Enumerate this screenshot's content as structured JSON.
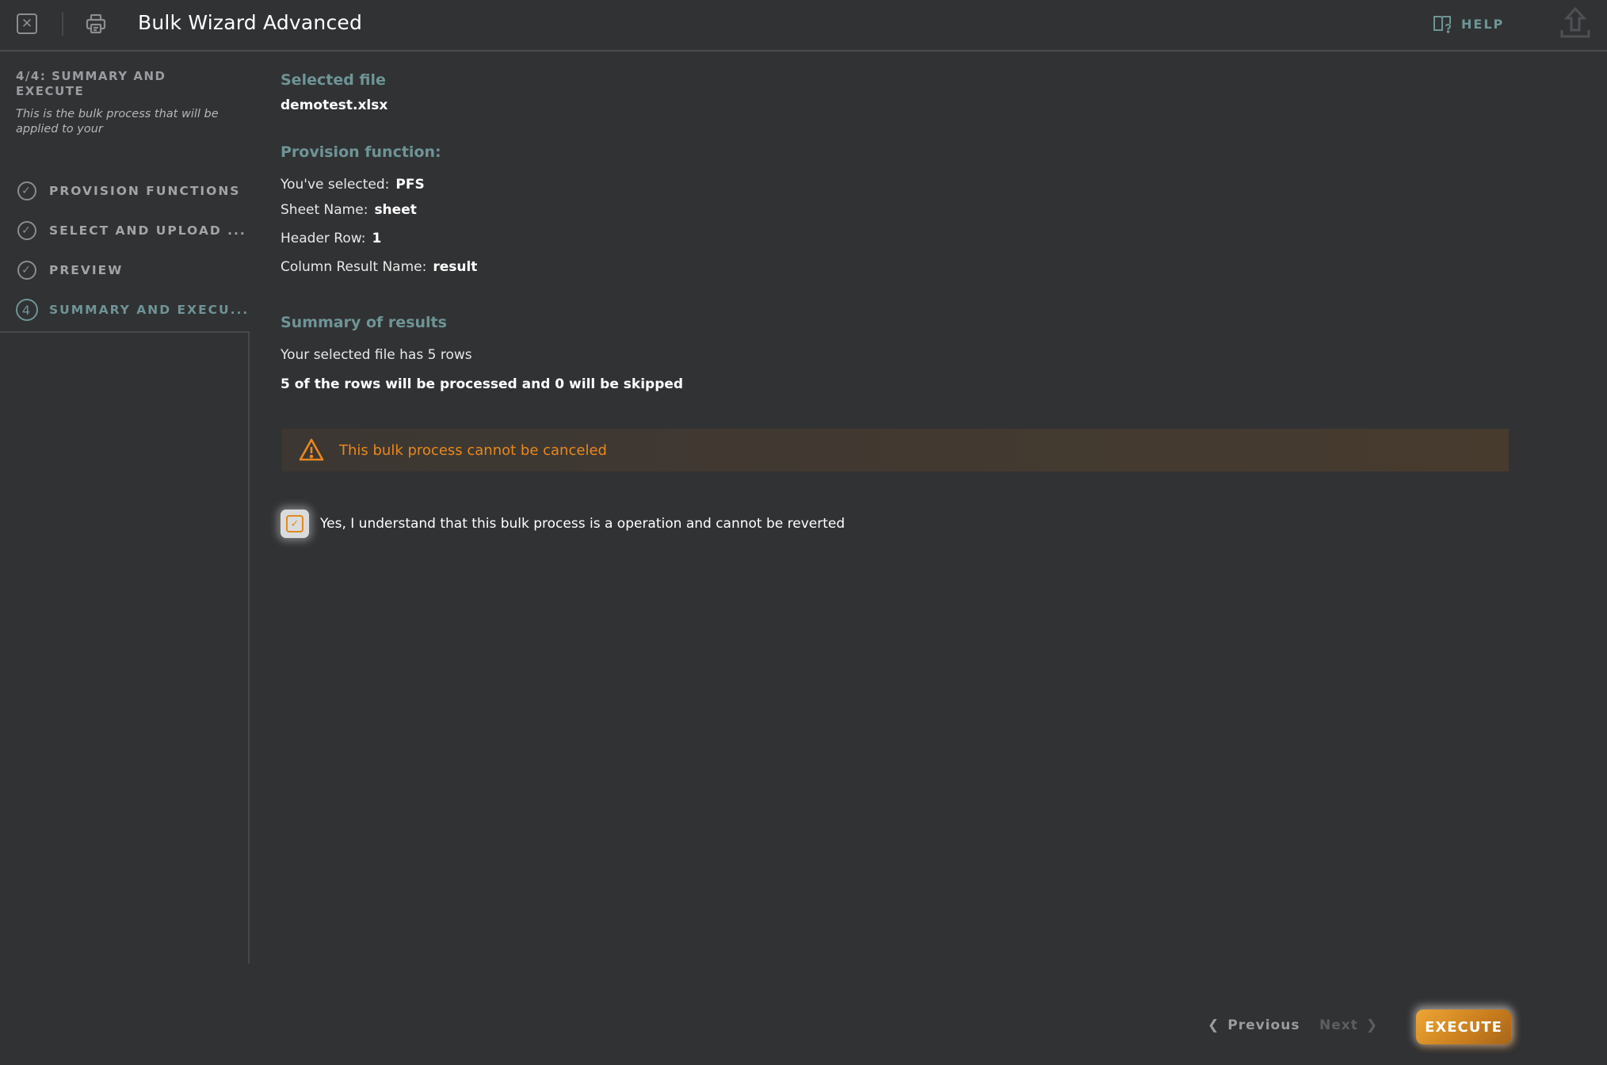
{
  "header": {
    "title": "Bulk Wizard Advanced",
    "help_label": "HELP",
    "icons": {
      "close": "close-square-icon",
      "print": "printer-icon",
      "help": "book-question-icon",
      "upload": "upload-icon"
    }
  },
  "sidebar": {
    "step_title": "4/4: SUMMARY AND EXECUTE",
    "step_description": "This is the bulk process that will be applied to your",
    "items": [
      {
        "label": "PROVISION FUNCTIONS",
        "icon": "check-circle-icon",
        "state": "completed"
      },
      {
        "label": "SELECT AND UPLOAD ...",
        "icon": "check-circle-icon",
        "state": "completed"
      },
      {
        "label": "PREVIEW",
        "icon": "check-circle-icon",
        "state": "completed"
      },
      {
        "label": "SUMMARY AND EXECU...",
        "icon": "step-number-icon",
        "number": "4",
        "state": "active"
      }
    ]
  },
  "main": {
    "selected_file": {
      "title": "Selected file",
      "value": "demotest.xlsx"
    },
    "provision": {
      "title": "Provision function:",
      "fields": [
        {
          "label": "You've selected:",
          "value": "PFS"
        },
        {
          "label": "Sheet Name:",
          "value": "sheet"
        },
        {
          "label": "Header Row:",
          "value": "1"
        },
        {
          "label": "Column Result Name:",
          "value": "result"
        }
      ]
    },
    "summary": {
      "title": "Summary of results",
      "rows_text": "Your selected file has 5 rows",
      "processed_text": "5 of the rows will be processed and 0 will be skipped"
    },
    "warning": {
      "icon": "warning-triangle-icon",
      "message": "This bulk process cannot be canceled",
      "color": "#e8881f"
    },
    "acknowledge": {
      "checked": true,
      "label": "Yes, I understand that this bulk process is a operation and cannot be reverted"
    }
  },
  "footer": {
    "previous_label": "Previous",
    "next_label": "Next",
    "next_disabled": true,
    "execute_label": "EXECUTE"
  },
  "colors": {
    "accent_teal": "#6e9496",
    "accent_orange": "#e08a1e",
    "background": "#313234"
  }
}
